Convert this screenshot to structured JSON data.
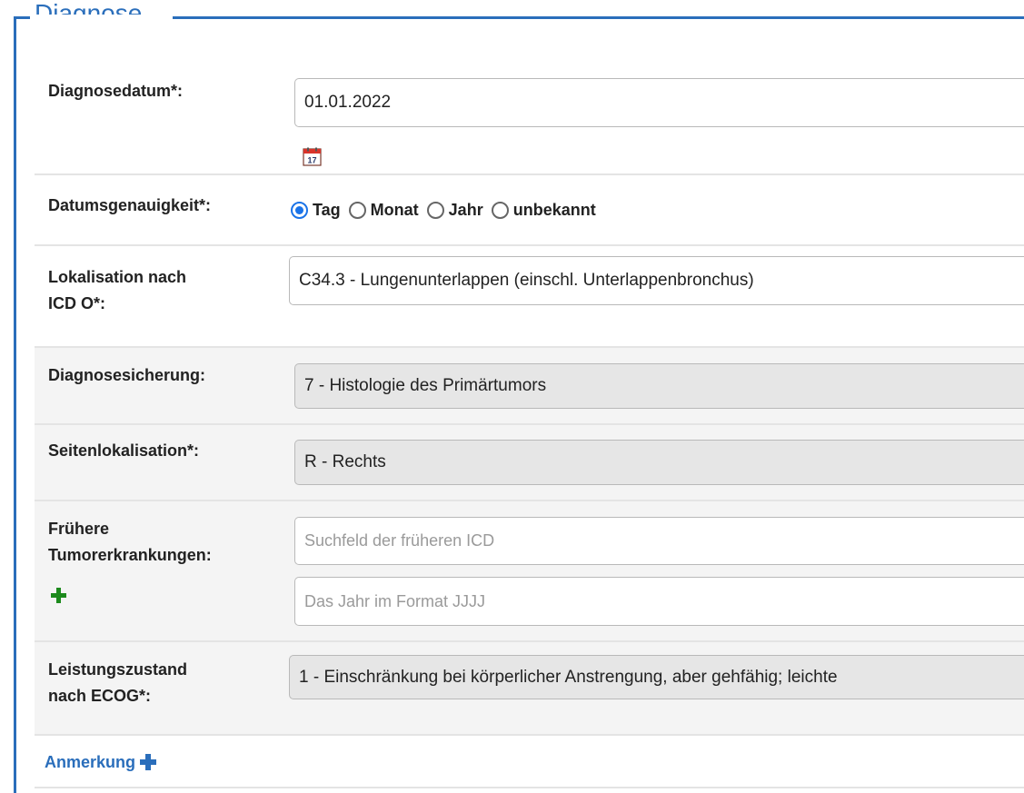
{
  "fieldset": {
    "legend": "Diagnose"
  },
  "diagnosedatum": {
    "label": "Diagnosedatum*:",
    "value": "01.01.2022",
    "calendar_day": "17"
  },
  "datumsgenauigkeit": {
    "label": "Datumsgenauigkeit*:",
    "options": [
      "Tag",
      "Monat",
      "Jahr",
      "unbekannt"
    ],
    "selected": "Tag"
  },
  "lokalisation": {
    "label_line1": "Lokalisation nach",
    "label_line2": "ICD O*:",
    "value": "C34.3 - Lungenunterlappen (einschl. Unterlappenbronchus)"
  },
  "diagnosesicherung": {
    "label": "Diagnosesicherung:",
    "value": "7 - Histologie des Primärtumors"
  },
  "seitenlokalisation": {
    "label": "Seitenlokalisation*:",
    "value": "R - Rechts"
  },
  "fruehere": {
    "label_line1": "Frühere",
    "label_line2": "Tumorerkrankungen:",
    "icd_placeholder": "Suchfeld der früheren ICD",
    "year_placeholder": "Das Jahr im Format JJJJ"
  },
  "leistungszustand": {
    "label_line1": "Leistungszustand",
    "label_line2": "nach ECOG*:",
    "value": "1 - Einschränkung bei körperlicher Anstrengung, aber gehfähig; leichte"
  },
  "anmerkung": {
    "label": "Anmerkung"
  },
  "colors": {
    "accent": "#2a6ebb",
    "add_green": "#1c8a1c",
    "radio_checked": "#1a73e8"
  }
}
